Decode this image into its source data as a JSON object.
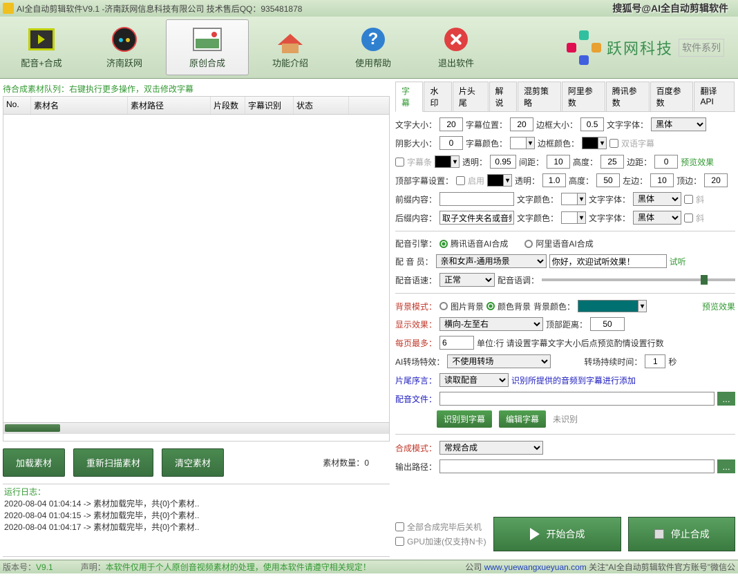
{
  "titlebar": {
    "title": "AI全自动剪辑软件V9.1 -济南跃网信息科技有限公司 技术售后QQ：935481878",
    "brand": "搜狐号@AI全自动剪辑软件"
  },
  "toolbar": {
    "items": [
      {
        "label": "配音+合成"
      },
      {
        "label": "济南跃网"
      },
      {
        "label": "原创合成"
      },
      {
        "label": "功能介绍"
      },
      {
        "label": "使用帮助"
      },
      {
        "label": "退出软件"
      }
    ],
    "logo_text": "跃网科技",
    "logo_sub": "软件系列"
  },
  "queue": {
    "header": "待合成素材队列：右键执行更多操作，双击修改字幕",
    "cols": {
      "no": "No.",
      "name": "素材名",
      "path": "素材路径",
      "seg": "片段数",
      "rec": "字幕识别",
      "status": "状态"
    }
  },
  "left_actions": {
    "load": "加载素材",
    "rescan": "重新扫描素材",
    "clear": "清空素材",
    "count_label": "素材数量：",
    "count": "0"
  },
  "log": {
    "title": "运行日志：",
    "lines": [
      "2020-08-04 01:04:14 -> 素材加载完毕，共{0}个素材..",
      "2020-08-04 01:04:15 -> 素材加载完毕，共{0}个素材..",
      "2020-08-04 01:04:17 -> 素材加载完毕，共{0}个素材.."
    ]
  },
  "right": {
    "tabs": [
      "字幕",
      "水印",
      "片头尾",
      "解说",
      "混剪策略",
      "阿里参数",
      "腾讯参数",
      "百度参数",
      "翻译API"
    ],
    "subtitle": {
      "font_size_lbl": "文字大小：",
      "font_size": "20",
      "position_lbl": "字幕位置：",
      "position": "20",
      "border_lbl": "边框大小：",
      "border": "0.5",
      "font_lbl": "文字字体：",
      "font": "黑体",
      "shadow_lbl": "阴影大小：",
      "shadow": "0",
      "subtitle_color_lbl": "字幕颜色：",
      "border_color_lbl": "边框颜色：",
      "bilingual_lbl": "双语字幕",
      "bar_lbl": "字幕条",
      "opacity_lbl": "透明：",
      "opacity": "0.95",
      "spacing_lbl": "间距：",
      "spacing": "10",
      "height_lbl": "高度：",
      "height": "25",
      "margin_lbl": "边距：",
      "margin": "0",
      "preview": "预览效果",
      "top_lbl": "顶部字幕设置：",
      "enable_lbl": "启用",
      "top_opacity": "1.0",
      "top_height": "50",
      "left_lbl": "左边：",
      "left": "10",
      "topm_lbl": "顶边：",
      "topm": "20",
      "prefix_lbl": "前缀内容：",
      "prefix": "",
      "text_color_lbl": "文字颜色：",
      "italic_lbl": "斜",
      "suffix_lbl": "后缀内容：",
      "suffix": "取子文件夹名或音频"
    },
    "voice": {
      "engine_lbl": "配音引擎：",
      "opt_tencent": "腾讯语音AI合成",
      "opt_ali": "阿里语音AI合成",
      "voice_lbl": "配 音 员：",
      "voice": "亲和女声-通用场景",
      "sample": "你好，欢迎试听效果！",
      "try": "试听",
      "speed_lbl": "配音语速：",
      "speed": "正常",
      "tone_lbl": "配音语调："
    },
    "bg": {
      "mode_lbl": "背景模式：",
      "opt_img": "图片背景",
      "opt_color": "颜色背景",
      "color_lbl": "背景颜色：",
      "bg_color": "#007070",
      "preview": "预览效果",
      "display_lbl": "显示效果：",
      "display": "横向-左至右",
      "top_lbl": "顶部距离：",
      "top": "50",
      "maxline_lbl": "每页最多：",
      "maxline": "6",
      "hint": "单位:行 请设置字幕文字大小后点预览酌情设置行数",
      "trans_lbl": "AI转场特效：",
      "trans": "不使用转场",
      "dur_lbl": "转场持续时间：",
      "dur": "1",
      "sec": "秒",
      "clip_lbl": "片尾序言：",
      "clip": "读取配音",
      "rec_hint": "识别所提供的音频到字幕进行添加",
      "file_lbl": "配音文件：",
      "btn_rec": "识别到字幕",
      "btn_edit": "编辑字幕",
      "status": "未识别",
      "compose_lbl": "合成模式：",
      "compose": "常规合成",
      "output_lbl": "输出路径：",
      "cb_shutdown": "全部合成完毕后关机",
      "cb_gpu": "GPU加速(仅支持N卡)",
      "btn_start": "开始合成",
      "btn_stop": "停止合成"
    }
  },
  "status": {
    "ver_lbl": "版本号：",
    "ver": "V9.1",
    "decl_lbl": "声明：",
    "decl": "本软件仅用于个人原创音视频素材的处理，使用本软件请遵守相关规定！",
    "company": "公司",
    "url": "www.yuewangxueyuan.com",
    "follow": " 关注\"AI全自动剪辑软件官方账号\"微信公"
  }
}
